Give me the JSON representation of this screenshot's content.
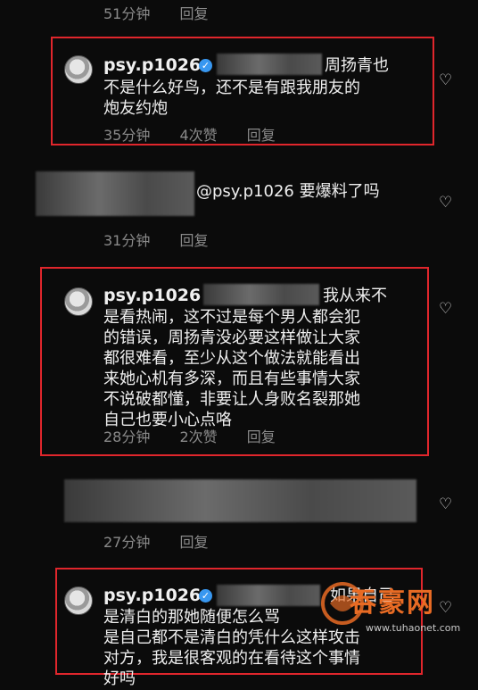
{
  "top_meta": {
    "time": "51分钟",
    "reply": "回复"
  },
  "comments": [
    {
      "username": "psy.p1026",
      "lines": [
        "周扬青也",
        "不是什么好鸟，还不是有跟我朋友的",
        "炮友约炮"
      ],
      "time": "35分钟",
      "likes": "4次赞",
      "reply": "回复"
    },
    {
      "mention": "@psy.p1026 要爆料了吗",
      "time": "31分钟",
      "reply": "回复"
    },
    {
      "username": "psy.p1026",
      "lines": [
        "我从来不",
        "是看热闹，这不过是每个男人都会犯",
        "的错误，周扬青没必要这样做让大家",
        "都很难看，至少从这个做法就能看出",
        "来她心机有多深，而且有些事情大家",
        "不说破都懂，非要让人身败名裂那她",
        "自己也要小心点咯"
      ],
      "time": "28分钟",
      "likes": "2次赞",
      "reply": "回复"
    },
    {
      "time": "27分钟",
      "reply": "回复"
    },
    {
      "username": "psy.p1026",
      "lines": [
        "如果自己",
        "是清白的那她随便怎么骂",
        "是自己都不是清白的凭什么这样攻击",
        "对方，我是很客观的在看待这个事情",
        "好吗"
      ]
    }
  ],
  "icons": {
    "heart": "heart-icon",
    "verified": "verified-badge-icon"
  },
  "watermark": {
    "text": "吞豪网",
    "url": "www.tuhaonet.com"
  },
  "colors": {
    "accent_box": "#e0262c",
    "verified": "#3897f0",
    "meta": "#8a8a8a"
  }
}
